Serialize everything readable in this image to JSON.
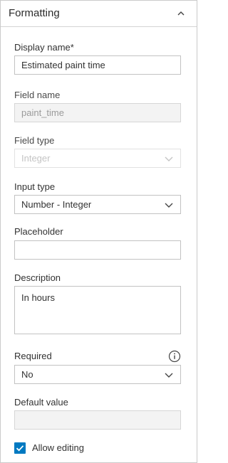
{
  "section": {
    "title": "Formatting",
    "collapse_icon": "chevron-up-icon"
  },
  "display_name": {
    "label": "Display name*",
    "value": "Estimated paint time"
  },
  "field_name": {
    "label": "Field name",
    "value": "paint_time"
  },
  "field_type": {
    "label": "Field type",
    "value": "Integer"
  },
  "input_type": {
    "label": "Input type",
    "value": "Number - Integer"
  },
  "placeholder": {
    "label": "Placeholder",
    "value": ""
  },
  "description": {
    "label": "Description",
    "value": "In hours"
  },
  "required": {
    "label": "Required",
    "value": "No",
    "info_icon": "info-icon"
  },
  "default_value": {
    "label": "Default value",
    "value": ""
  },
  "allow_editing": {
    "label": "Allow editing",
    "checked": true
  },
  "colors": {
    "accent": "#0079c1",
    "border": "#c2c2c2",
    "text": "#323232"
  }
}
